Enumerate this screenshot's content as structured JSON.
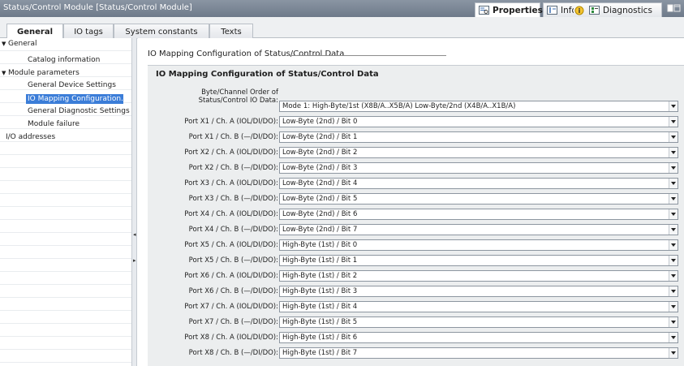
{
  "window": {
    "title": "Status/Control Module [Status/Control Module]",
    "tabs": [
      {
        "label": "Properties",
        "icon": "properties-icon"
      },
      {
        "label": "Info",
        "icon": "info-icon"
      },
      {
        "label": "Diagnostics",
        "icon": "diagnostics-icon"
      }
    ]
  },
  "subtabs": [
    "General",
    "IO tags",
    "System constants",
    "Texts"
  ],
  "nav": {
    "items": [
      {
        "label": "General",
        "expander": "▼"
      },
      {
        "label": "Catalog information"
      },
      {
        "label": "Module parameters",
        "expander": "▼"
      },
      {
        "label": "General Device Settings"
      },
      {
        "label": "IO Mapping Configuration..."
      },
      {
        "label": "General Diagnostic Settings"
      },
      {
        "label": "Module failure"
      },
      {
        "label": "I/O addresses"
      }
    ]
  },
  "content": {
    "breadcrumb": "IO Mapping Configuration of Status/Control Data",
    "section_title": "IO Mapping Configuration of Status/Control Data",
    "order": {
      "label_line1": "Byte/Channel Order of",
      "label_line2": "Status/Control IO Data:",
      "value": "Mode 1: High-Byte/1st (X8B/A..X5B/A) Low-Byte/2nd (X4B/A..X1B/A)"
    },
    "ports": [
      {
        "label": "Port X1 / Ch. A (IOL/DI/DO):",
        "value": "Low-Byte (2nd) / Bit 0"
      },
      {
        "label": "Port X1 / Ch. B (—/DI/DO):",
        "value": "Low-Byte (2nd) / Bit 1"
      },
      {
        "label": "Port X2 / Ch. A (IOL/DI/DO):",
        "value": "Low-Byte (2nd) / Bit 2"
      },
      {
        "label": "Port X2 / Ch. B (—/DI/DO):",
        "value": "Low-Byte (2nd) / Bit 3"
      },
      {
        "label": "Port X3 / Ch. A (IOL/DI/DO):",
        "value": "Low-Byte (2nd) / Bit 4"
      },
      {
        "label": "Port X3 / Ch. B (—/DI/DO):",
        "value": "Low-Byte (2nd) / Bit 5"
      },
      {
        "label": "Port X4 / Ch. A (IOL/DI/DO):",
        "value": "Low-Byte (2nd) / Bit 6"
      },
      {
        "label": "Port X4 / Ch. B (—/DI/DO):",
        "value": "Low-Byte (2nd) / Bit 7"
      },
      {
        "label": "Port X5 / Ch. A (IOL/DI/DO):",
        "value": "High-Byte (1st) / Bit 0"
      },
      {
        "label": "Port X5 / Ch. B (—/DI/DO):",
        "value": "High-Byte (1st) / Bit 1"
      },
      {
        "label": "Port X6 / Ch. A (IOL/DI/DO):",
        "value": "High-Byte (1st) / Bit 2"
      },
      {
        "label": "Port X6 / Ch. B (—/DI/DO):",
        "value": "High-Byte (1st) / Bit 3"
      },
      {
        "label": "Port X7 / Ch. A (IOL/DI/DO):",
        "value": "High-Byte (1st) / Bit 4"
      },
      {
        "label": "Port X7 / Ch. B (—/DI/DO):",
        "value": "High-Byte (1st) / Bit 5"
      },
      {
        "label": "Port X8 / Ch. A (IOL/DI/DO):",
        "value": "High-Byte (1st) / Bit 6"
      },
      {
        "label": "Port X8 / Ch. B (—/DI/DO):",
        "value": "High-Byte (1st) / Bit 7"
      }
    ]
  },
  "colors": {
    "title_bar": "#7b8696",
    "selection": "#3b7dd8",
    "panel_bg": "#eceeef"
  }
}
